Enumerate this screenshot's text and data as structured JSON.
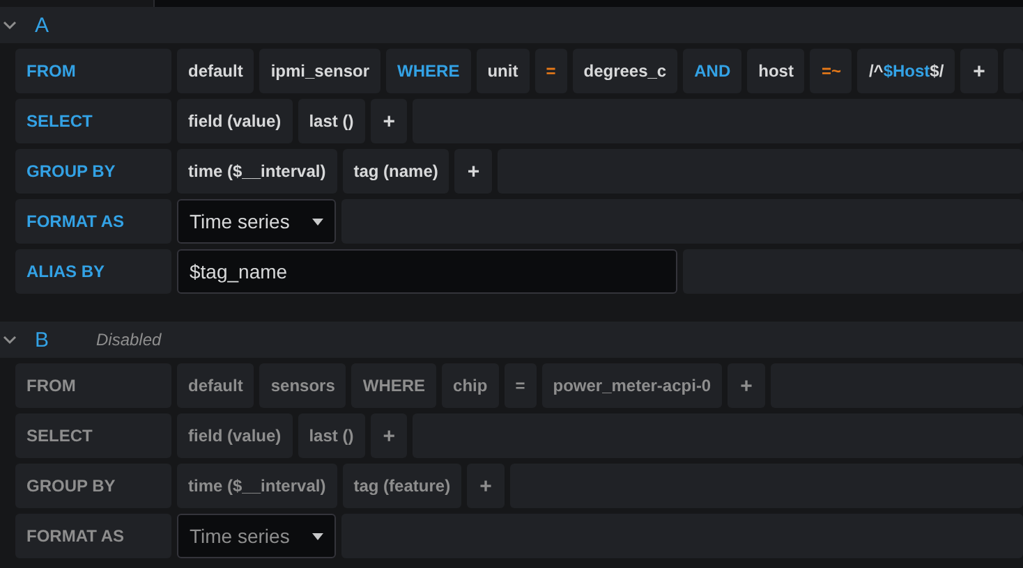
{
  "queries": [
    {
      "name": "A",
      "disabled": false,
      "rows": [
        {
          "label": "FROM",
          "kind": "segments",
          "segments": [
            {
              "text": "default",
              "kind": "plain"
            },
            {
              "text": "ipmi_sensor",
              "kind": "plain"
            },
            {
              "text": "WHERE",
              "kind": "keyword"
            },
            {
              "text": "unit",
              "kind": "plain"
            },
            {
              "text": "=",
              "kind": "operator"
            },
            {
              "text": "degrees_c",
              "kind": "plain"
            },
            {
              "text": "AND",
              "kind": "keyword"
            },
            {
              "text": "host",
              "kind": "plain"
            },
            {
              "text": "=~",
              "kind": "operator"
            },
            {
              "kind": "mixed",
              "parts": [
                {
                  "text": "/^",
                  "kind": "plain"
                },
                {
                  "text": "$Host",
                  "kind": "keyword"
                },
                {
                  "text": "$/",
                  "kind": "plain"
                }
              ]
            },
            {
              "text": "+",
              "kind": "plus"
            }
          ]
        },
        {
          "label": "SELECT",
          "kind": "segments",
          "segments": [
            {
              "text": "field (value)",
              "kind": "plain"
            },
            {
              "text": "last ()",
              "kind": "plain"
            },
            {
              "text": "+",
              "kind": "plus"
            }
          ]
        },
        {
          "label": "GROUP BY",
          "kind": "segments",
          "segments": [
            {
              "text": "time ($__interval)",
              "kind": "plain"
            },
            {
              "text": "tag (name)",
              "kind": "plain"
            },
            {
              "text": "+",
              "kind": "plus"
            }
          ]
        },
        {
          "label": "FORMAT AS",
          "kind": "select",
          "value": "Time series"
        },
        {
          "label": "ALIAS BY",
          "kind": "input",
          "value": "$tag_name"
        }
      ]
    },
    {
      "name": "B",
      "disabled": true,
      "note": "Disabled",
      "rows": [
        {
          "label": "FROM",
          "kind": "segments",
          "segments": [
            {
              "text": "default",
              "kind": "plain"
            },
            {
              "text": "sensors",
              "kind": "plain"
            },
            {
              "text": "WHERE",
              "kind": "keyword"
            },
            {
              "text": "chip",
              "kind": "plain"
            },
            {
              "text": "=",
              "kind": "operator"
            },
            {
              "text": "power_meter-acpi-0",
              "kind": "plain"
            },
            {
              "text": "+",
              "kind": "plus"
            }
          ]
        },
        {
          "label": "SELECT",
          "kind": "segments",
          "segments": [
            {
              "text": "field (value)",
              "kind": "plain"
            },
            {
              "text": "last ()",
              "kind": "plain"
            },
            {
              "text": "+",
              "kind": "plus"
            }
          ]
        },
        {
          "label": "GROUP BY",
          "kind": "segments",
          "segments": [
            {
              "text": "time ($__interval)",
              "kind": "plain"
            },
            {
              "text": "tag (feature)",
              "kind": "plain"
            },
            {
              "text": "+",
              "kind": "plus"
            }
          ]
        },
        {
          "label": "FORMAT AS",
          "kind": "select",
          "value": "Time series"
        }
      ]
    }
  ]
}
